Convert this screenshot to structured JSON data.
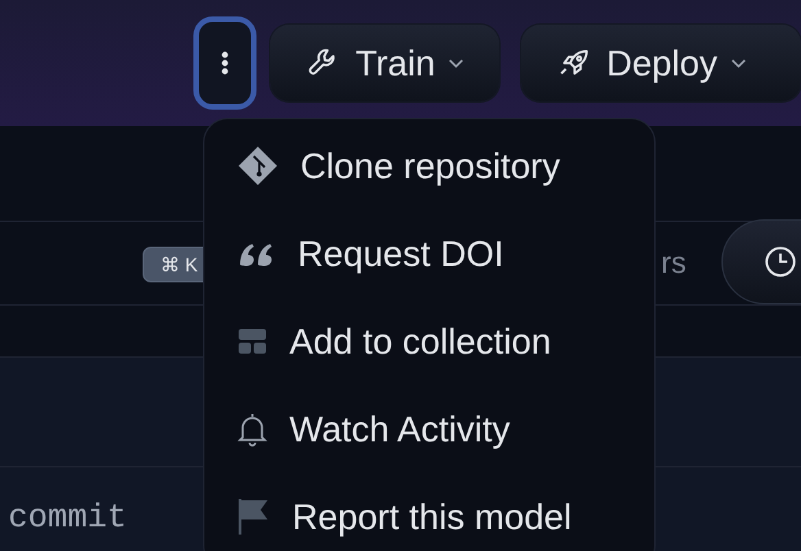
{
  "toolbar": {
    "more_button": {
      "focused": true
    },
    "buttons": [
      {
        "label": "Train",
        "kind": "train"
      },
      {
        "label": "Deploy",
        "kind": "deploy"
      }
    ]
  },
  "search_row": {
    "shortcut": "⌘ K",
    "trailing_text": "rs"
  },
  "code_row": {
    "text": "commit"
  },
  "menu": {
    "items": [
      {
        "label": "Clone repository",
        "kind": "git"
      },
      {
        "label": "Request DOI",
        "kind": "quote"
      },
      {
        "label": "Add to collection",
        "kind": "collection"
      },
      {
        "label": "Watch Activity",
        "kind": "bell"
      },
      {
        "label": "Report this model",
        "kind": "flag"
      }
    ]
  }
}
